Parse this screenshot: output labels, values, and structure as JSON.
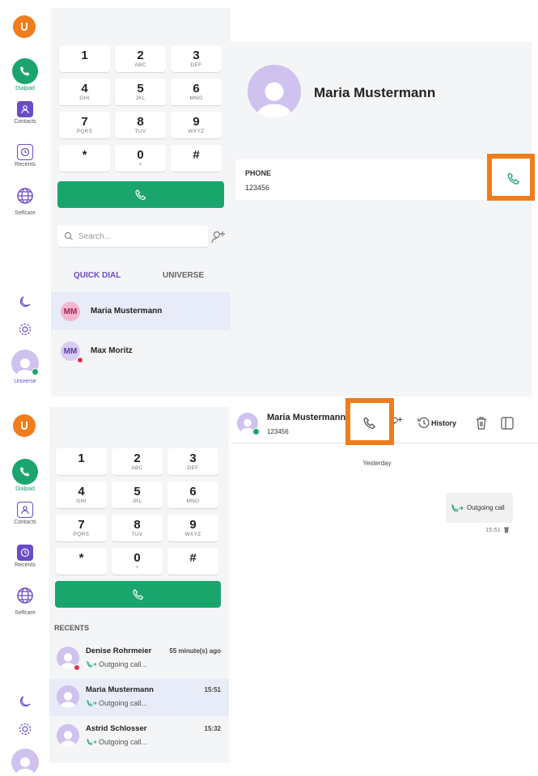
{
  "colors": {
    "accent": "#1aa56d",
    "brand": "#f07c1b",
    "nav": "#6a4bc8",
    "highlight": "#f07c1b"
  },
  "nav": {
    "dialpad": "Dialpad",
    "contacts": "Contacts",
    "recents": "Recents",
    "selfcare": "Selfcare",
    "universe": "Universe"
  },
  "keys": [
    {
      "d": "1",
      "l": ""
    },
    {
      "d": "2",
      "l": "ABC"
    },
    {
      "d": "3",
      "l": "DEF"
    },
    {
      "d": "4",
      "l": "GHI"
    },
    {
      "d": "5",
      "l": "JKL"
    },
    {
      "d": "6",
      "l": "MNO"
    },
    {
      "d": "7",
      "l": "PQRS"
    },
    {
      "d": "8",
      "l": "TUV"
    },
    {
      "d": "9",
      "l": "WXYZ"
    },
    {
      "d": "*",
      "l": ""
    },
    {
      "d": "0",
      "l": "+"
    },
    {
      "d": "#",
      "l": ""
    }
  ],
  "top": {
    "search_placeholder": "Search...",
    "tab_quick": "QUICK DIAL",
    "tab_universe": "UNIVERSE",
    "contacts": [
      {
        "initials": "MM",
        "name": "Maria Mustermann"
      },
      {
        "initials": "MM",
        "name": "Max Moritz"
      }
    ],
    "detail": {
      "name": "Maria Mustermann",
      "phone_label": "PHONE",
      "phone_value": "123456"
    }
  },
  "bottom": {
    "recents_label": "RECENTS",
    "recents": [
      {
        "name": "Denise Rohrmeier",
        "time": "55 minute(s) ago",
        "status": "Outgoing call..."
      },
      {
        "name": "Maria Mustermann",
        "time": "15:51",
        "status": "Outgoing call..."
      },
      {
        "name": "Astrid Schlosser",
        "time": "15:32",
        "status": "Outgoing call..."
      }
    ],
    "header": {
      "name": "Maria Mustermann",
      "number": "123456",
      "history": "History"
    },
    "day": "Yesterday",
    "message": {
      "text": "Outgoing call",
      "time": "15:51"
    }
  }
}
